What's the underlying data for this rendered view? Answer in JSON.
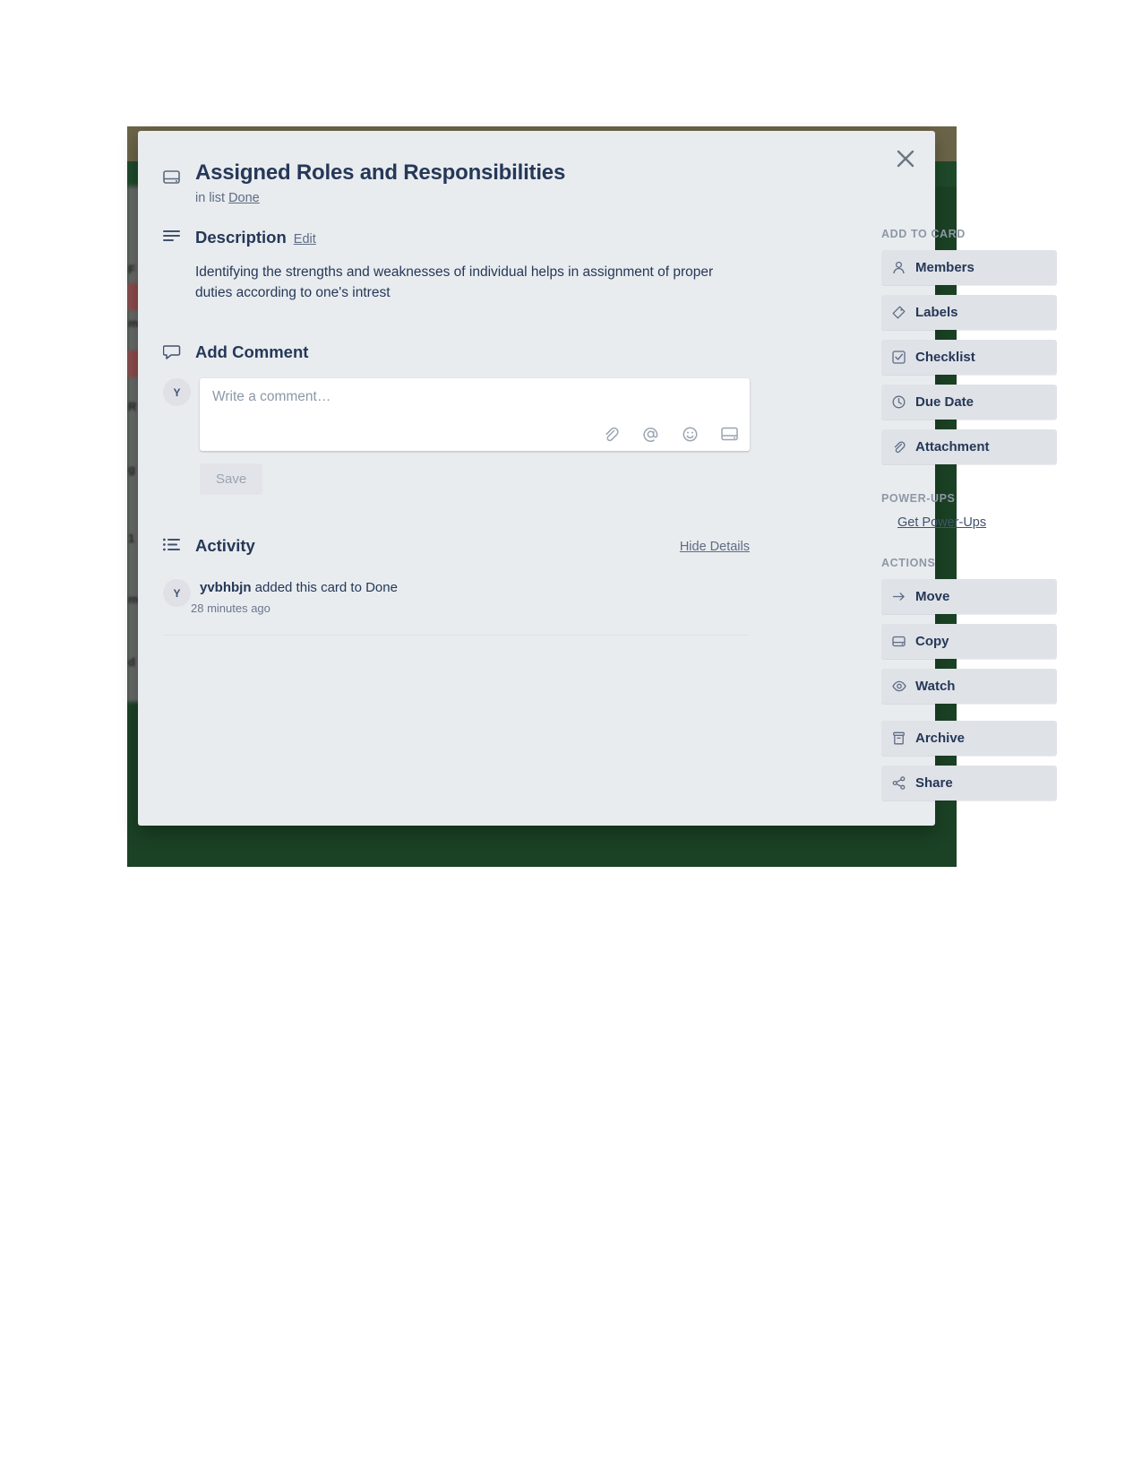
{
  "window": {
    "board_background_color": "#1b4225",
    "board_topbar_color": "#6b6448",
    "modal_background_color": "#e9ecef"
  },
  "card": {
    "title": "Assigned Roles and Responsibilities",
    "in_list_prefix": "in list",
    "list_name": "Done",
    "close_label": "×",
    "header_icon": "card-icon"
  },
  "description": {
    "heading": "Description",
    "edit_label": "Edit",
    "body": "Identifying the strengths and weaknesses of individual helps in assignment of proper duties according to one's intrest",
    "icon": "description-lines-icon"
  },
  "comment": {
    "heading": "Add Comment",
    "avatar_initial": "Y",
    "placeholder": "Write a comment…",
    "save_label": "Save",
    "icon": "comment-bubble-icon",
    "tools": [
      {
        "name": "attachment-icon",
        "title": "Attach a file"
      },
      {
        "name": "mention-icon",
        "title": "Mention a member"
      },
      {
        "name": "emoji-icon",
        "title": "Add emoji"
      },
      {
        "name": "card-image-icon",
        "title": "Attach a card"
      }
    ]
  },
  "activity": {
    "heading": "Activity",
    "hide_details_label": "Hide Details",
    "icon": "activity-list-icon",
    "items": [
      {
        "avatar_initial": "Y",
        "author": "yvbhbjn",
        "action": " added this card to Done",
        "time": "28 minutes ago"
      }
    ]
  },
  "sidebar": {
    "add_to_card_heading": "ADD TO CARD",
    "add_to_card_items": [
      {
        "label": "Members",
        "icon": "member-icon"
      },
      {
        "label": "Labels",
        "icon": "label-tag-icon"
      },
      {
        "label": "Checklist",
        "icon": "checklist-icon"
      },
      {
        "label": "Due Date",
        "icon": "clock-icon"
      },
      {
        "label": "Attachment",
        "icon": "attachment-icon"
      }
    ],
    "power_ups_heading": "POWER-UPS",
    "power_ups_link": "Get Power-Ups",
    "actions_heading": "ACTIONS",
    "actions_items": [
      {
        "label": "Move",
        "icon": "arrow-right-icon"
      },
      {
        "label": "Copy",
        "icon": "copy-card-icon"
      },
      {
        "label": "Watch",
        "icon": "eye-icon"
      }
    ],
    "actions_items_secondary": [
      {
        "label": "Archive",
        "icon": "archive-box-icon"
      },
      {
        "label": "Share",
        "icon": "share-icon"
      }
    ]
  }
}
